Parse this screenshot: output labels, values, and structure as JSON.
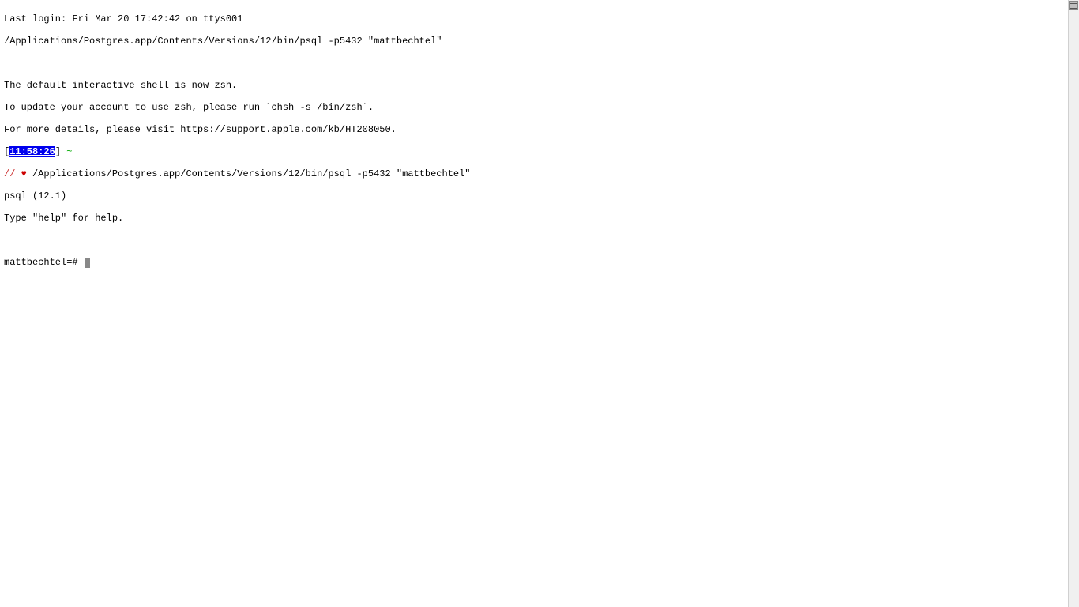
{
  "terminal": {
    "last_login": "Last login: Fri Mar 20 17:42:42 on ttys001",
    "command_1": "/Applications/Postgres.app/Contents/Versions/12/bin/psql -p5432 \"mattbechtel\"",
    "blank_1": "",
    "zsh_line_1": "The default interactive shell is now zsh.",
    "zsh_line_2": "To update your account to use zsh, please run `chsh -s /bin/zsh`.",
    "zsh_line_3": "For more details, please visit https://support.apple.com/kb/HT208050.",
    "prompt_bracket_open": "[",
    "prompt_timestamp": "11:58:26",
    "prompt_bracket_close": "] ",
    "prompt_tilde": "~",
    "prompt2_slashes": "// ",
    "prompt2_heart": "♥",
    "prompt2_command": " /Applications/Postgres.app/Contents/Versions/12/bin/psql -p5432 \"mattbechtel\"",
    "psql_version": "psql (12.1)",
    "psql_help": "Type \"help\" for help.",
    "blank_2": "",
    "psql_prompt": "mattbechtel=# "
  }
}
